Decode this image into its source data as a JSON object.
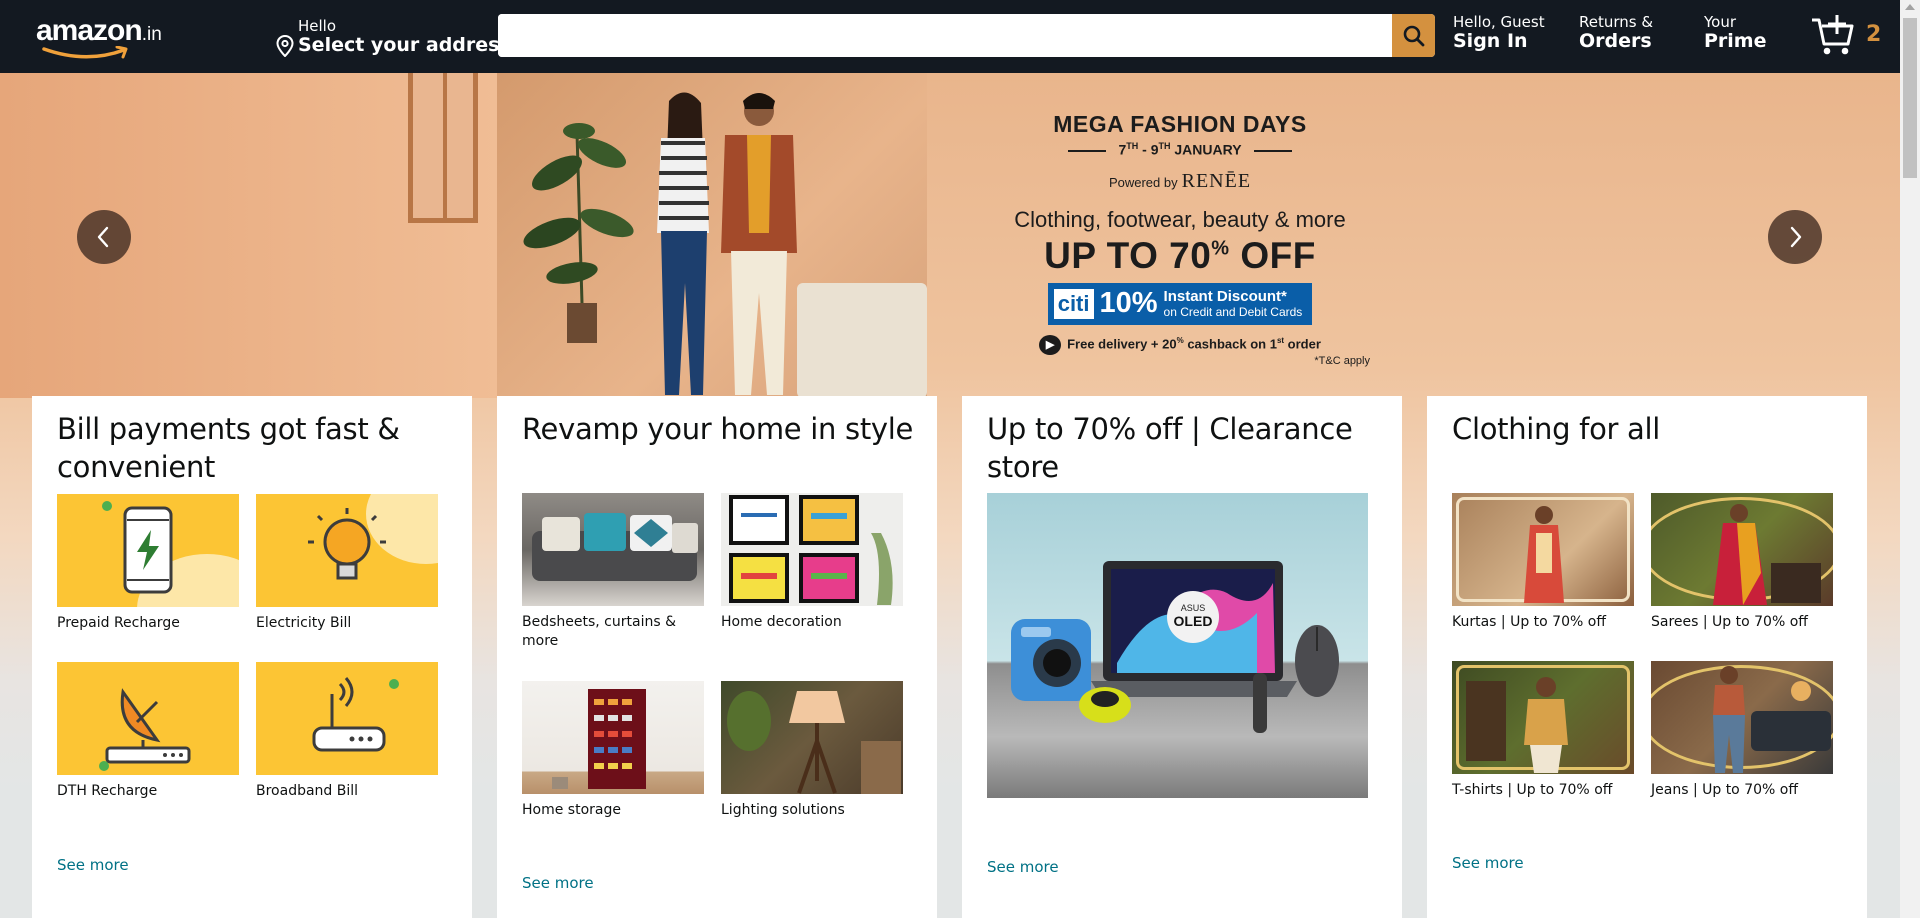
{
  "header": {
    "logo_text": "amazon",
    "logo_suffix": ".in",
    "address_hello": "Hello",
    "address_select": "Select your address",
    "search_placeholder": "",
    "account_hello": "Hello, Guest",
    "account_signin": "Sign In",
    "returns_line1": "Returns &",
    "returns_line2": "Orders",
    "prime_line1": "Your",
    "prime_line2": "Prime",
    "cart_count": "2"
  },
  "hero": {
    "title": "MEGA FASHION DAYS",
    "dates_day1": "7",
    "dates_sup1": "TH",
    "dates_sep": " - ",
    "dates_day2": "9",
    "dates_sup2": "TH",
    "dates_month": " JANUARY",
    "powered_by": "Powered by",
    "brand": "RENĒE",
    "subtitle": "Clothing, footwear, beauty & more",
    "offer_prefix": "UP TO 70",
    "offer_pct": "%",
    "offer_suffix": " OFF",
    "bank": "citi",
    "bank_discount": "10%",
    "bank_line1": "Instant Discount*",
    "bank_line2": "on Credit and Debit Cards",
    "delivery_prefix": "Free delivery + 20",
    "delivery_sup1": "%",
    "delivery_mid": " cashback on 1",
    "delivery_sup2": "st",
    "delivery_suffix": " order",
    "tnc": "*T&C apply"
  },
  "cards": [
    {
      "title": "Bill payments got fast & convenient",
      "tiles": [
        {
          "label": "Prepaid Recharge",
          "icon": "phone-bolt-icon"
        },
        {
          "label": "Electricity Bill",
          "icon": "bulb-icon"
        },
        {
          "label": "DTH Recharge",
          "icon": "dish-antenna-icon"
        },
        {
          "label": "Broadband Bill",
          "icon": "router-icon"
        }
      ],
      "see_more": "See more"
    },
    {
      "title": "Revamp your home in style",
      "tiles": [
        {
          "label": "Bedsheets, curtains & more"
        },
        {
          "label": "Home decoration"
        },
        {
          "label": "Home storage"
        },
        {
          "label": "Lighting solutions"
        }
      ],
      "see_more": "See more"
    },
    {
      "title": "Up to 70% off | Clearance store",
      "image_badge_top": "ASUS",
      "image_badge": "OLED",
      "see_more": "See more"
    },
    {
      "title": "Clothing for all",
      "tiles": [
        {
          "label": "Kurtas | Up to 70% off"
        },
        {
          "label": "Sarees | Up to 70% off"
        },
        {
          "label": "T-shirts | Up to 70% off"
        },
        {
          "label": "Jeans | Up to 70% off"
        }
      ],
      "see_more": "See more"
    }
  ],
  "colors": {
    "nav_bg": "#131921",
    "search_button": "#d4913f",
    "link": "#007185",
    "bill_yellow": "#fcc534",
    "citi_blue": "#0a5ea8"
  }
}
